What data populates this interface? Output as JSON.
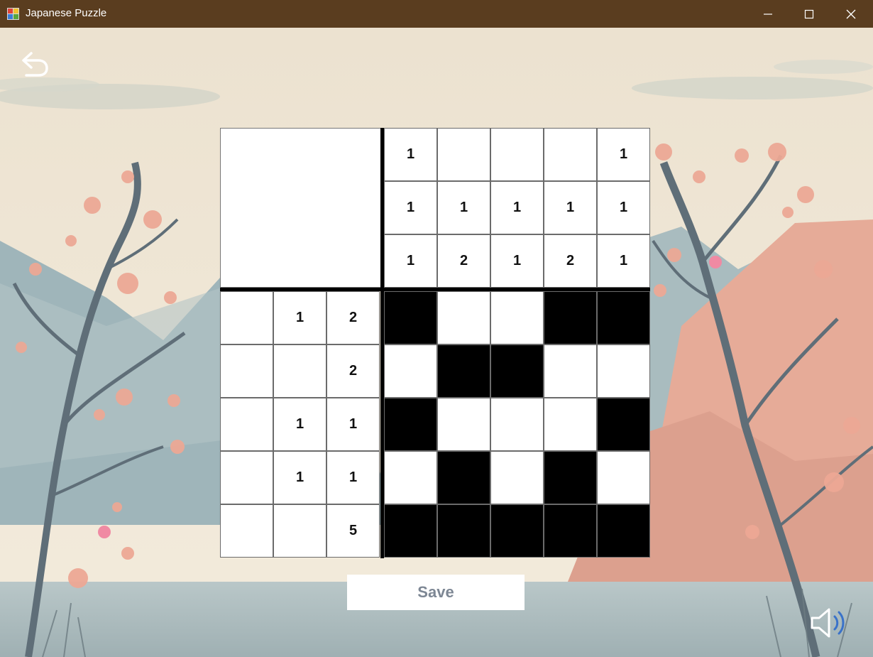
{
  "window": {
    "title": "Japanese Puzzle"
  },
  "icons": {
    "app": "app-icon",
    "minimize": "minimize-icon",
    "maximize": "maximize-icon",
    "close": "close-icon",
    "back": "undo-arrow-icon",
    "sound": "speaker-icon"
  },
  "puzzle": {
    "size": 5,
    "column_clues": [
      [
        "1",
        "1",
        "1"
      ],
      [
        "",
        "1",
        "2"
      ],
      [
        "",
        "1",
        "1"
      ],
      [
        "",
        "1",
        "2"
      ],
      [
        "1",
        "1",
        "1"
      ]
    ],
    "row_clues": [
      [
        "",
        "1",
        "2"
      ],
      [
        "",
        "",
        "2"
      ],
      [
        "",
        "1",
        "1"
      ],
      [
        "",
        "1",
        "1"
      ],
      [
        "",
        "",
        "5"
      ]
    ],
    "grid": [
      [
        1,
        0,
        0,
        1,
        1
      ],
      [
        0,
        1,
        1,
        0,
        0
      ],
      [
        1,
        0,
        0,
        0,
        1
      ],
      [
        0,
        1,
        0,
        1,
        0
      ],
      [
        1,
        1,
        1,
        1,
        1
      ]
    ]
  },
  "buttons": {
    "save_label": "Save"
  },
  "colors": {
    "titlebar": "#5a3d1f",
    "filled_cell": "#000000",
    "empty_cell": "#ffffff",
    "save_text": "#7d8794"
  }
}
